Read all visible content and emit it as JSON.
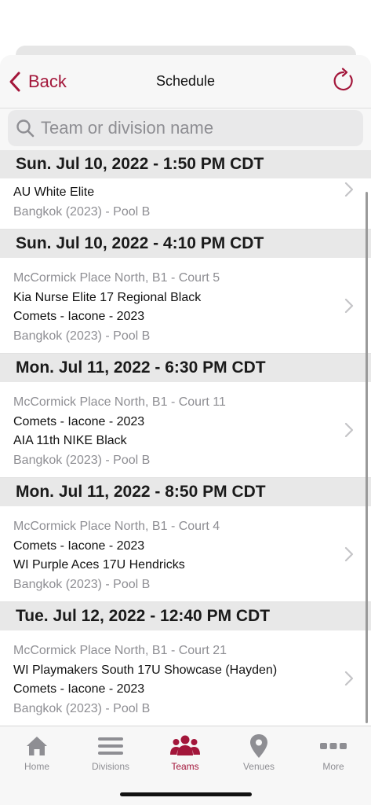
{
  "header": {
    "back_label": "Back",
    "title": "Schedule"
  },
  "search": {
    "placeholder": "Team or division name",
    "value": ""
  },
  "colors": {
    "accent": "#a3163a",
    "section_bg": "#e8e8e8",
    "secondary_text": "#8e8e93"
  },
  "sections": [
    {
      "header": "Sun. Jul 10, 2022 - 1:50 PM CDT",
      "games": [
        {
          "venue": "",
          "team1": "AU White Elite",
          "team2": "",
          "division": "Bangkok (2023) - Pool B"
        }
      ]
    },
    {
      "header": "Sun. Jul 10, 2022 - 4:10 PM CDT",
      "games": [
        {
          "venue": "McCormick Place North, B1 - Court 5",
          "team1": "Kia Nurse Elite 17 Regional Black",
          "team2": "Comets - Iacone - 2023",
          "division": "Bangkok (2023) - Pool B"
        }
      ]
    },
    {
      "header": "Mon. Jul 11, 2022 - 6:30 PM CDT",
      "games": [
        {
          "venue": "McCormick Place North, B1 - Court 11",
          "team1": "Comets - Iacone - 2023",
          "team2": "AIA 11th NIKE Black",
          "division": "Bangkok (2023) - Pool B"
        }
      ]
    },
    {
      "header": "Mon. Jul 11, 2022 - 8:50 PM CDT",
      "games": [
        {
          "venue": "McCormick Place North, B1 - Court 4",
          "team1": "Comets - Iacone - 2023",
          "team2": "WI Purple Aces 17U Hendricks",
          "division": "Bangkok (2023) - Pool B"
        }
      ]
    },
    {
      "header": "Tue. Jul 12, 2022 - 12:40 PM CDT",
      "games": [
        {
          "venue": "McCormick Place North, B1 - Court 21",
          "team1": "WI Playmakers South 17U Showcase (Hayden)",
          "team2": "Comets - Iacone - 2023",
          "division": "Bangkok (2023) - Pool B"
        }
      ]
    }
  ],
  "tabbar": {
    "items": [
      {
        "label": "Home",
        "icon": "home-icon",
        "active": false
      },
      {
        "label": "Divisions",
        "icon": "list-icon",
        "active": false
      },
      {
        "label": "Teams",
        "icon": "people-icon",
        "active": true
      },
      {
        "label": "Venues",
        "icon": "location-pin-icon",
        "active": false
      },
      {
        "label": "More",
        "icon": "ellipsis-icon",
        "active": false
      }
    ]
  }
}
